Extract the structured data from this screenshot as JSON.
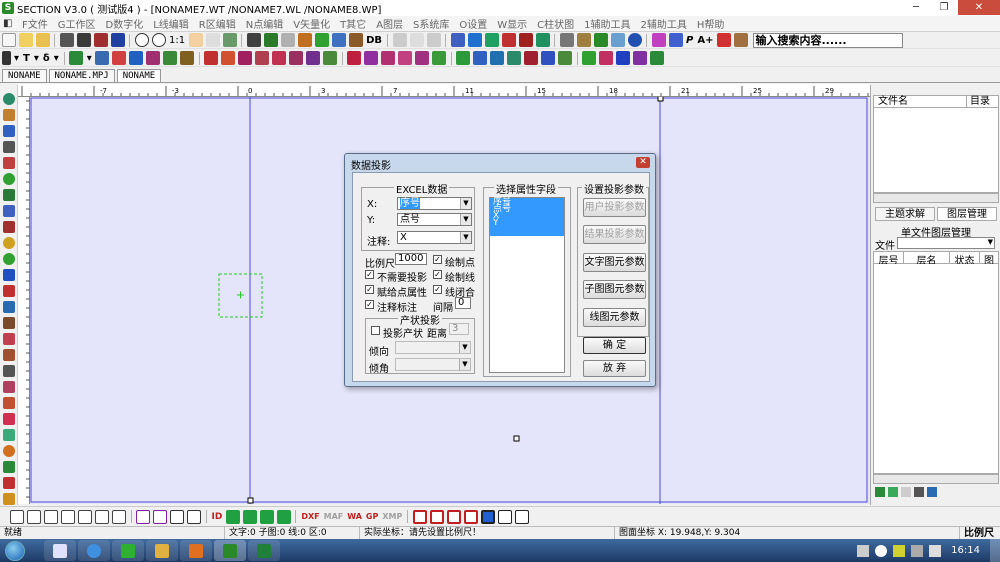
{
  "window": {
    "title": "SECTION V3.0 ( 测试版4 ) - [NONAME7.WT /NONAME7.WL /NONAME8.WP]",
    "min": "─",
    "max": "❐",
    "close": "✕"
  },
  "menu": [
    "F文件",
    "G工作区",
    "D数字化",
    "L线编辑",
    "R区编辑",
    "N点编辑",
    "V矢量化",
    "T其它",
    "A图层",
    "S系统库",
    "O设置",
    "W显示",
    "C柱状图",
    "1辅助工具",
    "2辅助工具",
    "H帮助"
  ],
  "toolbar1": {
    "zoom_label": "1:1",
    "db_label": "DB",
    "p_label": "P",
    "a_label": "A+",
    "search_text": "输入搜索内容......"
  },
  "toolbar2": {
    "t_label": "T",
    "delta_label": "δ"
  },
  "doc_tabs": [
    "NONAME",
    "NONAME.MPJ",
    "NONAME"
  ],
  "ruler": {
    "ticks": [
      "-7",
      "-3",
      "0",
      "3",
      "7",
      "11",
      "15",
      "18",
      "21",
      "25",
      "29"
    ]
  },
  "dialog": {
    "title": "数据投影",
    "excel": {
      "group": "EXCEL数据",
      "x_label": "X:",
      "x_value": "序号",
      "y_label": "Y:",
      "y_value": "点号",
      "note_label": "注释:",
      "note_value": "X"
    },
    "scale": {
      "label": "比例尺",
      "value": "1000"
    },
    "checks": [
      {
        "label": "绘制点",
        "checked": true
      },
      {
        "label": "不需要投影",
        "checked": true
      },
      {
        "label": "绘制线",
        "checked": true
      },
      {
        "label": "赋给点属性",
        "checked": true
      },
      {
        "label": "线闭合",
        "checked": true
      },
      {
        "label": "注释标注",
        "checked": true
      }
    ],
    "interval": {
      "label": "间隔",
      "value": "0"
    },
    "occurrence": {
      "group": "产状投影",
      "check_label": "投影产状",
      "checked": false,
      "dist_label": "距离",
      "dist_value": "3",
      "dip_dir_label": "倾向",
      "dip_label": "倾角"
    },
    "fields": {
      "group": "选择属性字段",
      "items": [
        "序号",
        "点号",
        "X",
        "Y"
      ]
    },
    "params": {
      "group": "设置投影参数",
      "user_btn": "用户投影参数",
      "result_btn": "结果投影参数",
      "text_btn": "文字图元参数",
      "sub_btn": "子图图元参数",
      "line_btn": "线图元参数"
    },
    "ok_btn": "确  定",
    "cancel_btn": "放  弃"
  },
  "right_panel": {
    "col_file": "文件名",
    "col_dir": "目录",
    "tab_topic": "主题求解",
    "tab_layer": "图层管理",
    "layer_title": "单文件图层管理",
    "file_label": "文件",
    "cols": [
      "层号",
      "层名",
      "状态",
      "图"
    ]
  },
  "bottom_toolbar": {
    "id_label": "ID",
    "dxf": "DXF",
    "maf": "MAF",
    "wa": "WA",
    "gp": "GP",
    "xmp": "XMP"
  },
  "status": {
    "ready": "就绪",
    "counts": "文字:0 子图:0 线:0 区:0",
    "real_coord": "实际坐标：请先设置比例尺！",
    "map_coord": "图面坐标 X: 19.948,Y: 9.304",
    "scale": "比例尺"
  },
  "taskbar": {
    "time": "16:14"
  }
}
